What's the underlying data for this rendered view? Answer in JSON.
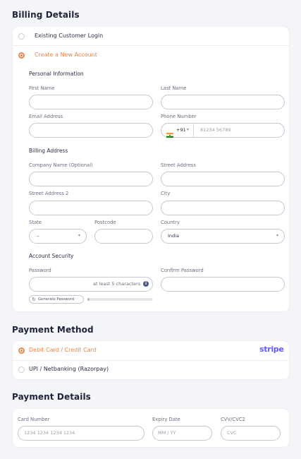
{
  "billing": {
    "title": "Billing Details",
    "existing_login": "Existing Customer Login",
    "create_account": "Create a New Account",
    "personal_info": "Personal Information",
    "first_name_label": "First Name",
    "last_name_label": "Last Name",
    "email_label": "Email Address",
    "phone_label": "Phone Number",
    "phone_code": "+91",
    "phone_placeholder": "81234 56789",
    "billing_address": "Billing Address",
    "company_label": "Company Name (Optional)",
    "street_label": "Street Address",
    "street2_label": "Street Address 2",
    "city_label": "City",
    "state_label": "State",
    "state_value": "–",
    "postcode_label": "Postcode",
    "country_label": "Country",
    "country_value": "India",
    "account_security": "Account Security",
    "password_label": "Password",
    "password_hint": "at least 5 characters",
    "confirm_password_label": "Confirm Password",
    "generate_password": "Generate Password"
  },
  "payment_method": {
    "title": "Payment Method",
    "card_option": "Debit Card / Credit Card",
    "stripe_logo": "stripe",
    "upi_option": "UPI / Netbanking (Razorpay)"
  },
  "payment_details": {
    "title": "Payment Details",
    "card_number_label": "Card Number",
    "card_number_placeholder": "1234 1234 1234 1234",
    "expiry_label": "Expiry Date",
    "expiry_placeholder": "MM / YY",
    "cvc_label": "CVV/CVC2",
    "cvc_placeholder": "CVC"
  },
  "colors": {
    "accent": "#ef8348",
    "stripe": "#635bff"
  },
  "icons": [
    "india-flag-icon",
    "chevron-down-icon",
    "info-icon",
    "refresh-icon"
  ]
}
